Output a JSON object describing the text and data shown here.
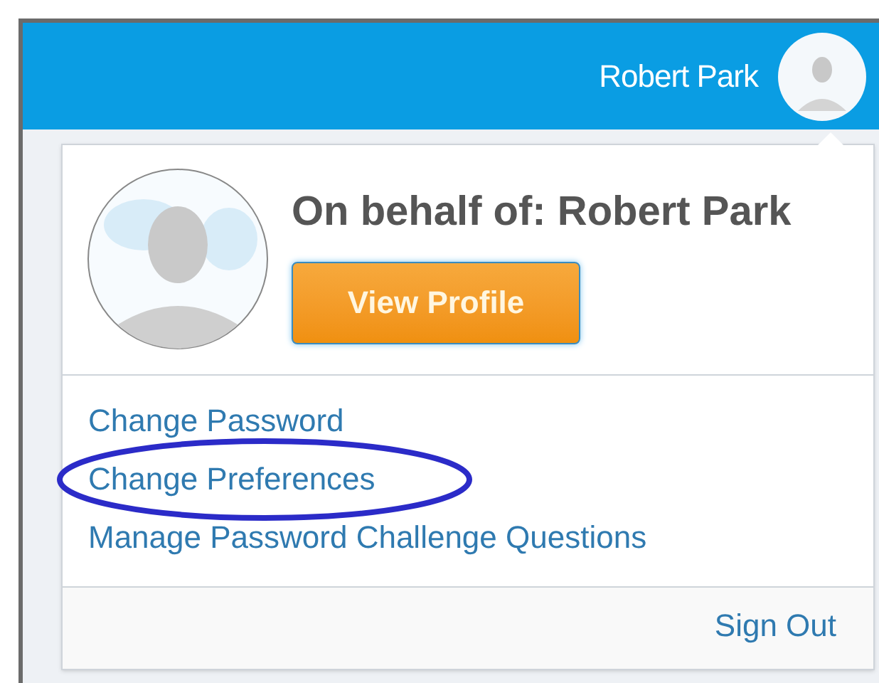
{
  "header": {
    "user_name": "Robert Park"
  },
  "menu": {
    "title": "On behalf of: Robert Park",
    "profile_button": "View Profile",
    "links": [
      {
        "label": "Change Password",
        "highlighted": false
      },
      {
        "label": "Change Preferences",
        "highlighted": true
      },
      {
        "label": "Manage Password Challenge Questions",
        "highlighted": false
      }
    ],
    "footer_link": "Sign Out"
  }
}
